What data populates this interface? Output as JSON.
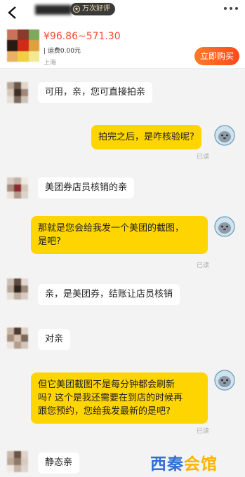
{
  "header": {
    "badge_label": "万次好评",
    "badge_icon": "medal-icon"
  },
  "product": {
    "price": "¥96.86~571.30",
    "shipping": "| 运费0.00元",
    "location": "上海",
    "buy_label": "立即购买",
    "colors": {
      "price": "#ff4a2f",
      "button": "#ff5a1f"
    }
  },
  "messages": [
    {
      "from": "seller",
      "text": "可用，亲，您可直接拍亲"
    },
    {
      "from": "buyer",
      "text": "拍完之后，是咋核验呢?",
      "status": "已读"
    },
    {
      "from": "seller",
      "text": "美团券店员核销的亲"
    },
    {
      "from": "buyer",
      "lines": [
        "那就是您会给我发一个美团的截图，",
        "是吧?"
      ],
      "status": "已读"
    },
    {
      "from": "seller",
      "text": "亲，是美团券，结账让店员核销"
    },
    {
      "from": "seller",
      "text": "对亲"
    },
    {
      "from": "buyer",
      "lines": [
        "但它美团截图不是每分钟都会刷新",
        "吗? 这个是我还需要在到店的时候再",
        "跟您预约，您给我发最新的是吧?"
      ],
      "status": "已读"
    },
    {
      "from": "seller",
      "text": "静态亲"
    }
  ],
  "watermark": {
    "part1": "西秦",
    "part2": "会馆"
  },
  "colors": {
    "buyer_bubble": "#ffd500",
    "seller_bubble": "#ffffff",
    "background": "#f3f3f3"
  }
}
